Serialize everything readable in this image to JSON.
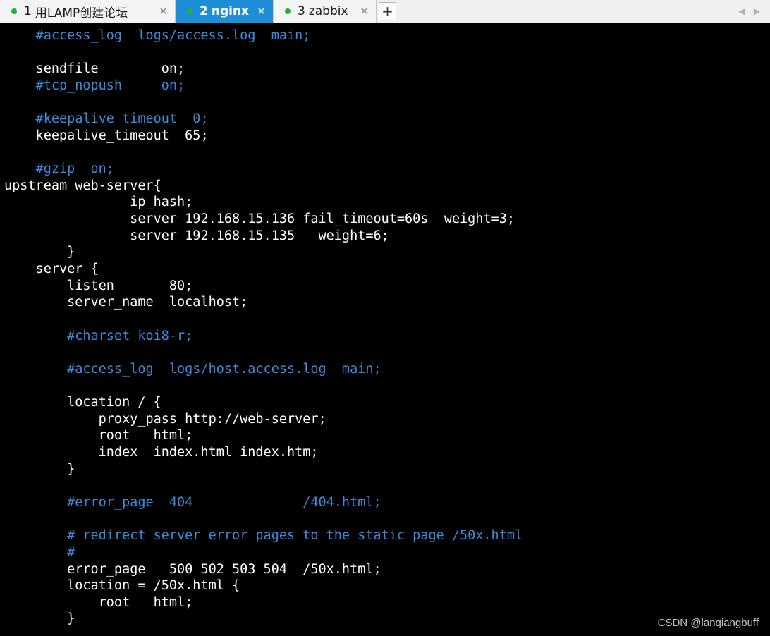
{
  "tabs": [
    {
      "number": "1",
      "label": "用LAMP创建论坛",
      "close": "✕",
      "active": false
    },
    {
      "number": "2",
      "label": "nginx",
      "close": "✕",
      "active": true
    },
    {
      "number": "3",
      "label": "zabbix",
      "close": "✕",
      "active": false
    }
  ],
  "new_tab_label": "+",
  "scroll_left": "◀",
  "scroll_right": "▶",
  "colors": {
    "active_tab": "#1e8fd6",
    "tab_dot": "#20b13a",
    "terminal_bg": "#000000",
    "terminal_text": "#ffffff",
    "comment_text": "#3d8ad8"
  },
  "terminal_lines": [
    {
      "text": "    #access_log  logs/access.log  main;",
      "comment": true
    },
    {
      "text": "",
      "comment": false
    },
    {
      "text": "    sendfile        on;",
      "comment": false
    },
    {
      "text": "    #tcp_nopush     on;",
      "comment": true
    },
    {
      "text": "",
      "comment": false
    },
    {
      "text": "    #keepalive_timeout  0;",
      "comment": true
    },
    {
      "text": "    keepalive_timeout  65;",
      "comment": false
    },
    {
      "text": "",
      "comment": false
    },
    {
      "text": "    #gzip  on;",
      "comment": true
    },
    {
      "text": "upstream web-server{",
      "comment": false
    },
    {
      "text": "                ip_hash;",
      "comment": false
    },
    {
      "text": "                server 192.168.15.136 fail_timeout=60s  weight=3;",
      "comment": false
    },
    {
      "text": "                server 192.168.15.135   weight=6;",
      "comment": false
    },
    {
      "text": "        }",
      "comment": false
    },
    {
      "text": "    server {",
      "comment": false
    },
    {
      "text": "        listen       80;",
      "comment": false
    },
    {
      "text": "        server_name  localhost;",
      "comment": false
    },
    {
      "text": "",
      "comment": false
    },
    {
      "text": "        #charset koi8-r;",
      "comment": true
    },
    {
      "text": "",
      "comment": false
    },
    {
      "text": "        #access_log  logs/host.access.log  main;",
      "comment": true
    },
    {
      "text": "",
      "comment": false
    },
    {
      "text": "        location / {",
      "comment": false
    },
    {
      "text": "            proxy_pass http://web-server;",
      "comment": false
    },
    {
      "text": "            root   html;",
      "comment": false
    },
    {
      "text": "            index  index.html index.htm;",
      "comment": false
    },
    {
      "text": "        }",
      "comment": false
    },
    {
      "text": "",
      "comment": false
    },
    {
      "text": "        #error_page  404              /404.html;",
      "comment": true
    },
    {
      "text": "",
      "comment": false
    },
    {
      "text": "        # redirect server error pages to the static page /50x.html",
      "comment": true
    },
    {
      "text": "        #",
      "comment": true
    },
    {
      "text": "        error_page   500 502 503 504  /50x.html;",
      "comment": false
    },
    {
      "text": "        location = /50x.html {",
      "comment": false
    },
    {
      "text": "            root   html;",
      "comment": false
    },
    {
      "text": "        }",
      "comment": false
    }
  ],
  "watermark": "CSDN @lanqiangbuff"
}
